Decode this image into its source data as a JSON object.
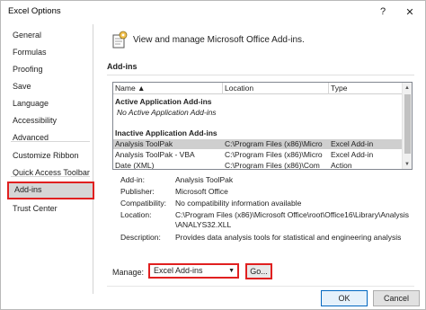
{
  "window": {
    "title": "Excel Options",
    "help_glyph": "?",
    "close_glyph": "✕"
  },
  "sidebar": {
    "items": [
      {
        "label": "General"
      },
      {
        "label": "Formulas"
      },
      {
        "label": "Proofing"
      },
      {
        "label": "Save"
      },
      {
        "label": "Language"
      },
      {
        "label": "Accessibility"
      },
      {
        "label": "Advanced"
      },
      {
        "label": "Customize Ribbon"
      },
      {
        "label": "Quick Access Toolbar"
      },
      {
        "label": "Add-ins",
        "selected": true
      },
      {
        "label": "Trust Center"
      }
    ]
  },
  "main": {
    "header_text": "View and manage Microsoft Office Add-ins.",
    "section_title": "Add-ins",
    "list": {
      "columns": [
        "Name ▲",
        "Location",
        "Type"
      ],
      "active_group": "Active Application Add-ins",
      "active_empty": "No Active Application Add-ins",
      "inactive_group": "Inactive Application Add-ins",
      "rows": [
        {
          "name": "Analysis ToolPak",
          "location": "C:\\Program Files (x86)\\Micro",
          "type": "Excel Add-in",
          "selected": true
        },
        {
          "name": "Analysis ToolPak - VBA",
          "location": "C:\\Program Files (x86)\\Micro",
          "type": "Excel Add-in"
        },
        {
          "name": "Date (XML)",
          "location": "C:\\Program Files (x86)\\Com",
          "type": "Action"
        }
      ]
    },
    "details": {
      "addin_label": "Add-in:",
      "addin_value": "Analysis ToolPak",
      "publisher_label": "Publisher:",
      "publisher_value": "Microsoft Office",
      "compat_label": "Compatibility:",
      "compat_value": "No compatibility information available",
      "location_label": "Location:",
      "location_value_1": "C:\\Program Files (x86)\\Microsoft Office\\root\\Office16\\Library\\Analysis",
      "location_value_2": "\\ANALYS32.XLL",
      "description_label": "Description:",
      "description_value": "Provides data analysis tools for statistical and engineering analysis"
    },
    "manage": {
      "label": "Manage:",
      "selected": "Excel Add-ins",
      "go_label": "Go..."
    }
  },
  "footer": {
    "ok_label": "OK",
    "cancel_label": "Cancel"
  },
  "colors": {
    "highlight_border": "#e02020",
    "selected_row": "#cfcfcf"
  }
}
